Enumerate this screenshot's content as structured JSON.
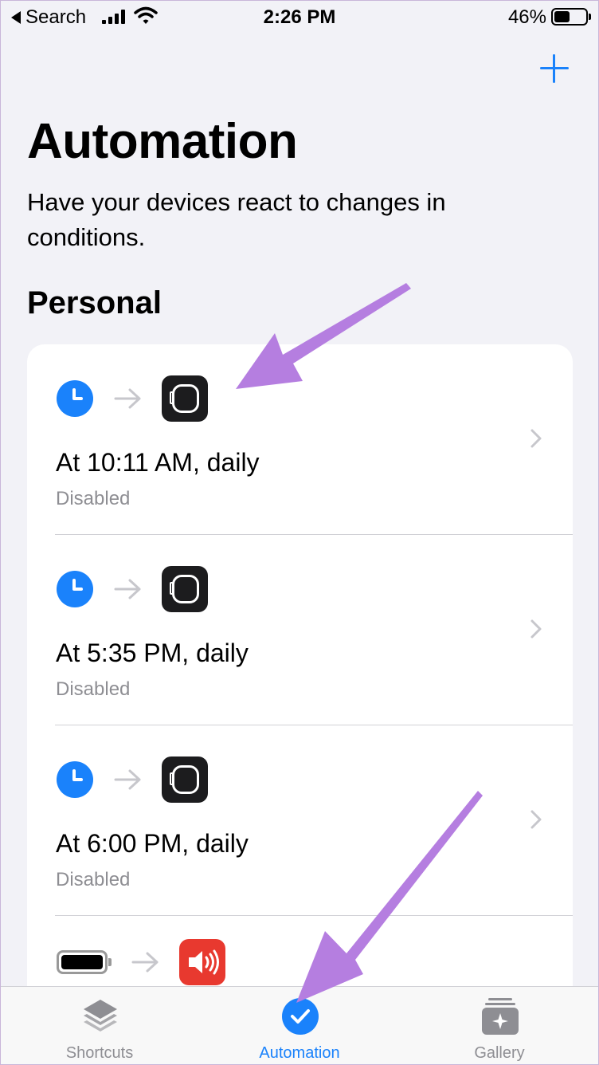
{
  "status_bar": {
    "back_label": "Search",
    "time": "2:26 PM",
    "battery_percent": "46%",
    "battery_level": 0.46
  },
  "header": {
    "title": "Automation",
    "subtitle": "Have your devices react to changes in conditions.",
    "add_icon": "plus-icon"
  },
  "section": {
    "title": "Personal",
    "items": [
      {
        "title": "At 10:11 AM, daily",
        "status": "Disabled",
        "trigger_icon": "clock-icon",
        "action_icon": "watch-app-icon"
      },
      {
        "title": "At 5:35 PM, daily",
        "status": "Disabled",
        "trigger_icon": "clock-icon",
        "action_icon": "watch-app-icon"
      },
      {
        "title": "At 6:00 PM, daily",
        "status": "Disabled",
        "trigger_icon": "clock-icon",
        "action_icon": "watch-app-icon"
      },
      {
        "trigger_icon": "battery-icon",
        "action_icon": "speaker-app-icon"
      }
    ]
  },
  "tab_bar": {
    "tabs": [
      {
        "label": "Shortcuts",
        "icon": "layers-icon",
        "active": false
      },
      {
        "label": "Automation",
        "icon": "checkmark-circle-icon",
        "active": true
      },
      {
        "label": "Gallery",
        "icon": "gallery-stack-icon",
        "active": false
      }
    ]
  },
  "colors": {
    "accent": "#1a82fb",
    "background": "#f2f2f7",
    "annotation_arrow": "#b57ee0"
  }
}
